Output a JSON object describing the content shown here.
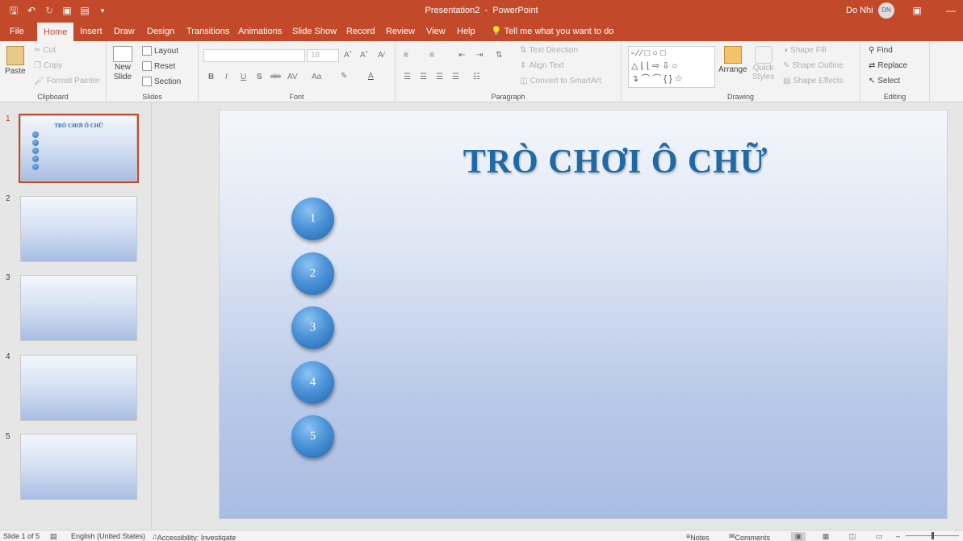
{
  "titlebar": {
    "document": "Presentation2",
    "separator": "-",
    "app": "PowerPoint",
    "title_full": "Presentation2  -  PowerPoint",
    "user_name": "Do Nhi",
    "user_initials": "DN",
    "qat_icons": [
      "save-icon",
      "undo-icon",
      "redo-icon",
      "present-icon",
      "new-slide-icon",
      "customize-icon"
    ]
  },
  "tabs": [
    "File",
    "Home",
    "Insert",
    "Draw",
    "Design",
    "Transitions",
    "Animations",
    "Slide Show",
    "Record",
    "Review",
    "View",
    "Help"
  ],
  "active_tab": "Home",
  "tell_me": "Tell me what you want to do",
  "ribbon": {
    "clipboard": {
      "paste": "Paste",
      "cut": "Cut",
      "copy": "Copy",
      "format_painter": "Format Painter",
      "label": "Clipboard"
    },
    "slides": {
      "new_slide_line1": "New",
      "new_slide_line2": "Slide",
      "layout": "Layout",
      "reset": "Reset",
      "section": "Section",
      "label": "Slides"
    },
    "font": {
      "font_name": "",
      "font_size": "18",
      "bold": "B",
      "italic": "I",
      "underline": "U",
      "shadow": "S",
      "strike": "abc",
      "spacing": "AV",
      "case": "Aa",
      "label": "Font"
    },
    "paragraph": {
      "text_direction": "Text Direction",
      "align_text": "Align Text",
      "convert_smartart": "Convert to SmartArt",
      "label": "Paragraph"
    },
    "drawing": {
      "arrange": "Arrange",
      "quick_styles_line1": "Quick",
      "quick_styles_line2": "Styles",
      "shape_fill": "Shape Fill",
      "shape_outline": "Shape Outline",
      "shape_effects": "Shape Effects",
      "label": "Drawing"
    },
    "editing": {
      "find": "Find",
      "replace": "Replace",
      "select": "Select",
      "label": "Editing"
    }
  },
  "slides_panel": [
    {
      "number": "1",
      "selected": true,
      "title": "TRÒ CHƠI Ô CHỮ"
    },
    {
      "number": "2",
      "selected": false
    },
    {
      "number": "3",
      "selected": false
    },
    {
      "number": "4",
      "selected": false
    },
    {
      "number": "5",
      "selected": false
    }
  ],
  "slide": {
    "title": "TRÒ CHƠI Ô CHỮ",
    "circles": [
      "1",
      "2",
      "3",
      "4",
      "5"
    ]
  },
  "statusbar": {
    "slide_info": "Slide 1 of 5",
    "language": "English (United States)",
    "accessibility": "Accessibility: Investigate",
    "notes": "Notes",
    "comments": "Comments"
  },
  "colors": {
    "accent": "#c24a2a",
    "title_blue": "#1f6aa5",
    "circle_blue": "#4b93d8"
  }
}
